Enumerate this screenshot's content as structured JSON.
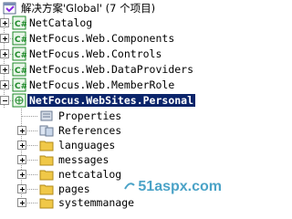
{
  "solution": {
    "label": "解决方案'Global' (7 个项目)"
  },
  "projects": [
    {
      "label": "NetCatalog"
    },
    {
      "label": "NetFocus.Web.Components"
    },
    {
      "label": "NetFocus.Web.Controls"
    },
    {
      "label": "NetFocus.Web.DataProviders"
    },
    {
      "label": "NetFocus.Web.MemberRole"
    },
    {
      "label": "NetFocus.WebSites.Personal"
    }
  ],
  "children": [
    {
      "label": "Properties",
      "icon": "properties-icon"
    },
    {
      "label": "References",
      "icon": "references-icon"
    },
    {
      "label": "languages",
      "icon": "folder-icon"
    },
    {
      "label": "messages",
      "icon": "folder-icon"
    },
    {
      "label": "netcatalog",
      "icon": "folder-icon"
    },
    {
      "label": "pages",
      "icon": "folder-icon"
    },
    {
      "label": "systemmanage",
      "icon": "folder-icon"
    }
  ],
  "watermark": {
    "text": "51aspx.com"
  },
  "colors": {
    "selection": "#0a246a",
    "folder": "#f0c848",
    "project_green": "#1f8a2a",
    "watermark": "#4ba3c7"
  }
}
